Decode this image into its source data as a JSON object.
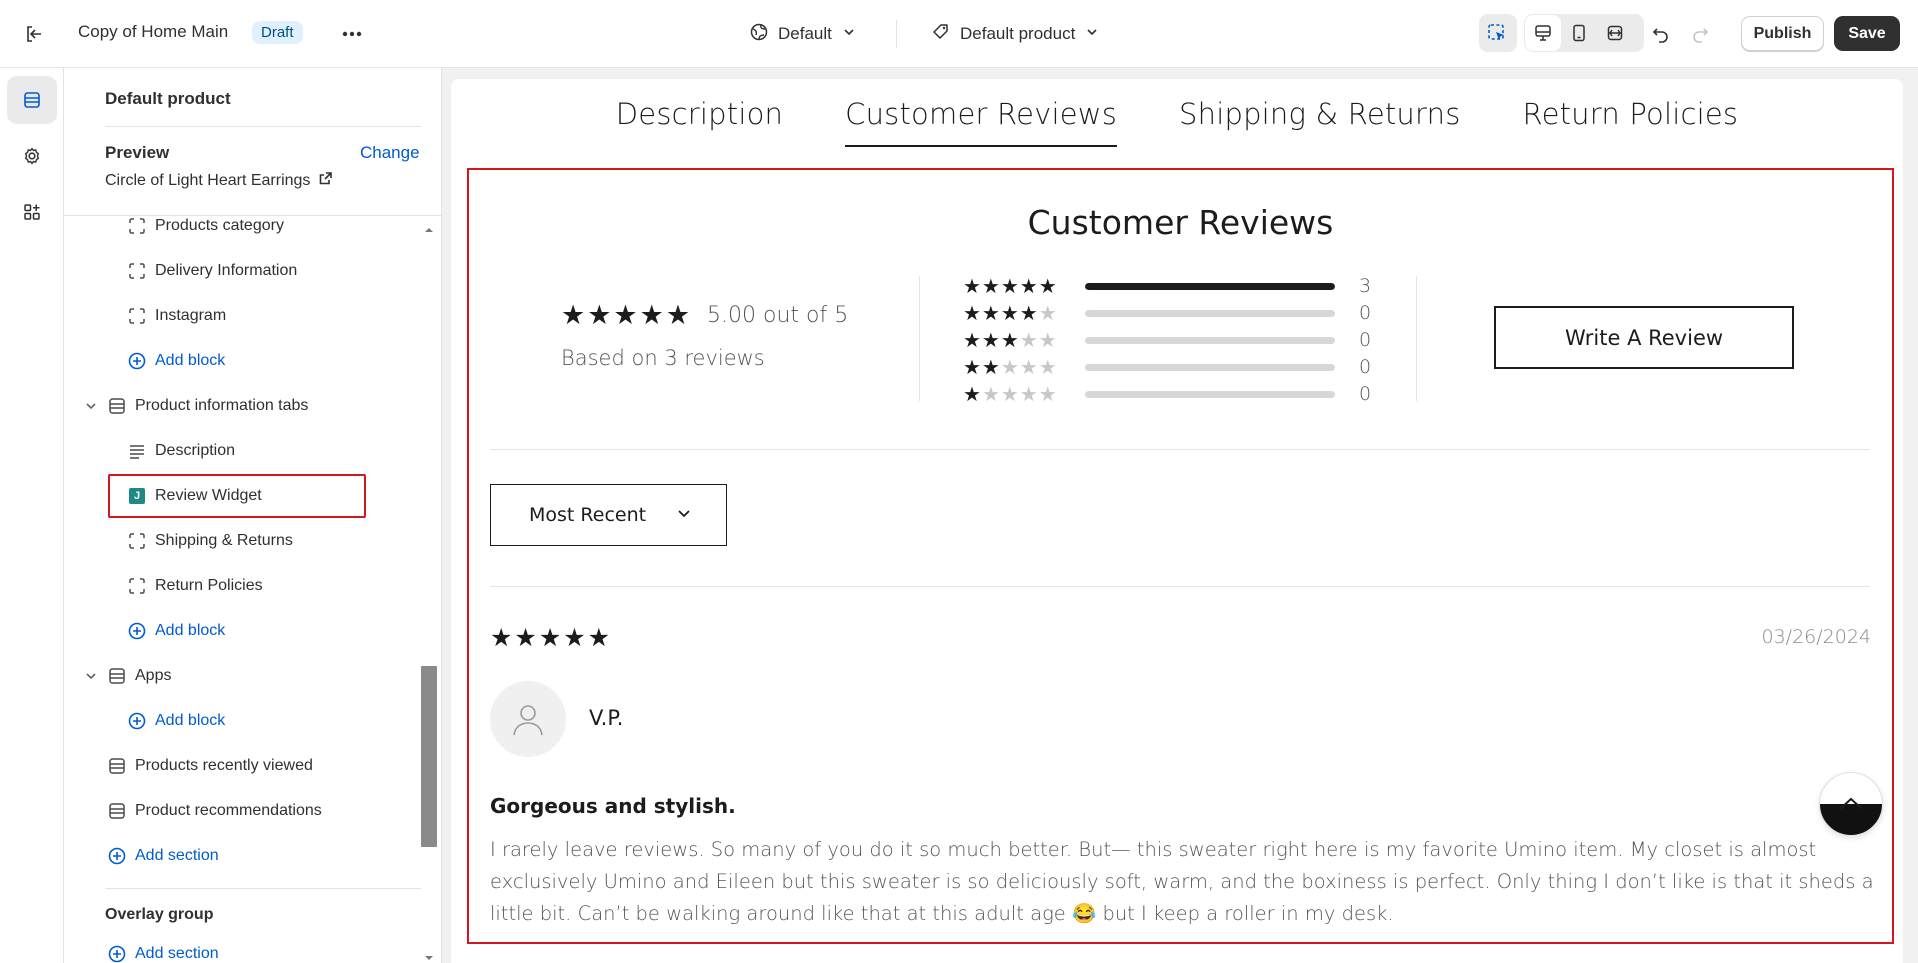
{
  "topbar": {
    "theme_name": "Copy of Home Main",
    "status_badge": "Draft",
    "template_select": "Default",
    "product_select": "Default product",
    "publish_label": "Publish",
    "save_label": "Save"
  },
  "sidebar": {
    "header_title": "Default product",
    "preview_label": "Preview",
    "change_label": "Change",
    "preview_product": "Circle of Light Heart Earrings",
    "items": [
      {
        "label": "Products category",
        "kind": "block"
      },
      {
        "label": "Delivery Information",
        "kind": "block"
      },
      {
        "label": "Instagram",
        "kind": "block"
      },
      {
        "label": "Add block",
        "kind": "add"
      },
      {
        "label": "Product information tabs",
        "kind": "section"
      },
      {
        "label": "Description",
        "kind": "text-block"
      },
      {
        "label": "Review Widget",
        "kind": "app-block",
        "selected": true
      },
      {
        "label": "Shipping & Returns",
        "kind": "block"
      },
      {
        "label": "Return Policies",
        "kind": "block"
      },
      {
        "label": "Add block",
        "kind": "add"
      },
      {
        "label": "Apps",
        "kind": "section"
      },
      {
        "label": "Add block",
        "kind": "add"
      },
      {
        "label": "Products recently viewed",
        "kind": "section"
      },
      {
        "label": "Product recommendations",
        "kind": "section"
      },
      {
        "label": "Add section",
        "kind": "add"
      }
    ],
    "overlay_group_label": "Overlay group",
    "overlay_add_section": "Add section"
  },
  "preview": {
    "tabs": [
      "Description",
      "Customer Reviews",
      "Shipping & Returns",
      "Return Policies"
    ],
    "active_tab": "Customer Reviews",
    "widget": {
      "title": "Customer Reviews",
      "summary_stars": "★★★★★",
      "average_text": "5.00 out of 5",
      "based_on": "Based on 3 reviews",
      "histogram": [
        {
          "stars": 5,
          "count": "3",
          "fraction": 1.0
        },
        {
          "stars": 4,
          "count": "0",
          "fraction": 0
        },
        {
          "stars": 3,
          "count": "0",
          "fraction": 0
        },
        {
          "stars": 2,
          "count": "0",
          "fraction": 0
        },
        {
          "stars": 1,
          "count": "0",
          "fraction": 0
        }
      ],
      "write_review_label": "Write A Review",
      "sort_label": "Most Recent",
      "review": {
        "stars": "★★★★★",
        "date": "03/26/2024",
        "author": "V.P.",
        "heading": "Gorgeous and stylish.",
        "body": "I rarely leave reviews. So many of you do it so much better. But— this sweater right here is my favorite Umino item. My closet is almost exclusively Umino and Eileen but this sweater is so deliciously soft, warm, and the boxiness is perfect. Only thing I don’t like is that it sheds a little bit. Can’t be walking around like that at this adult age 😂 but I keep a roller in my desk."
      }
    }
  },
  "colors": {
    "accent_blue": "#005bd3",
    "selection_red": "#d4161e",
    "primary_dark": "#303030"
  }
}
